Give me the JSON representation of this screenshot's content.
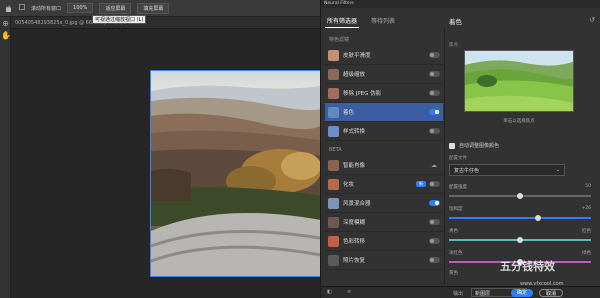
{
  "options_bar": {
    "autoscroll_label": "滚动所有窗口",
    "zoom": "100%",
    "fit_screen": "适应屏幕",
    "fill_screen": "填充屏幕"
  },
  "tooltip": "可视通过缩放视口 (L)",
  "document": {
    "tab_title": "00540548293825x_0.jpg @ 66.7% (RGB/8)"
  },
  "neural": {
    "title": "Neural Filters",
    "tabs": [
      "所有筛选器",
      "等待列表"
    ],
    "sections": [
      {
        "heading": "特色滤镜",
        "items": [
          {
            "label": "皮肤平滑度",
            "state": "off",
            "color": "#c98d73"
          },
          {
            "label": "超级缩放",
            "state": "off",
            "color": "#8a6a5a"
          },
          {
            "label": "移除 JPEG 伪影",
            "state": "off",
            "color": "#a46d5f"
          },
          {
            "label": "着色",
            "state": "on",
            "color": "#5f8bb8",
            "active": true
          },
          {
            "label": "样式转换",
            "state": "off",
            "color": "#6a8fc8"
          }
        ]
      },
      {
        "heading": "BETA",
        "items": [
          {
            "label": "智能肖像",
            "state": "cloud",
            "color": "#8a6450"
          },
          {
            "label": "化妆",
            "state": "new",
            "badge": "新",
            "color": "#b56a4a"
          },
          {
            "label": "风景混合器",
            "state": "on",
            "color": "#7a95b5"
          },
          {
            "label": "深度模糊",
            "state": "off",
            "color": "#6b5a52"
          },
          {
            "label": "色彩转移",
            "state": "off",
            "color": "#c46046"
          },
          {
            "label": "照片恢复",
            "state": "off",
            "color": "#5a5a5a"
          }
        ]
      }
    ],
    "panel": {
      "title": "着色",
      "focus_label": "焦点",
      "preview_caption": "单击以选择焦点",
      "auto_color_label": "自动调整图像颜色",
      "profile_label": "配置文件",
      "profile_value": "复古牛仔色",
      "sliders": [
        {
          "name": "配置强度",
          "value": "50",
          "pos": 0.5,
          "color": "#666666"
        },
        {
          "name": "饱和度",
          "value": "+26",
          "pos": 0.63,
          "color": "#2d7ef7"
        },
        {
          "name": "青色",
          "value": "红色",
          "pos": 0.5,
          "color": "#5fb6b6"
        },
        {
          "name": "洋红色",
          "value": "绿色",
          "pos": 0.5,
          "color": "#b55fb5"
        },
        {
          "name": "黄色",
          "value": "",
          "pos": 0.5,
          "color": "#b5b55f"
        }
      ]
    },
    "footer": {
      "output_label": "输出",
      "output_value": "新图层",
      "ok": "确定",
      "cancel": "取消"
    }
  },
  "watermark": {
    "brand": "五分钱特效",
    "url": "www.vfxcool.com"
  }
}
